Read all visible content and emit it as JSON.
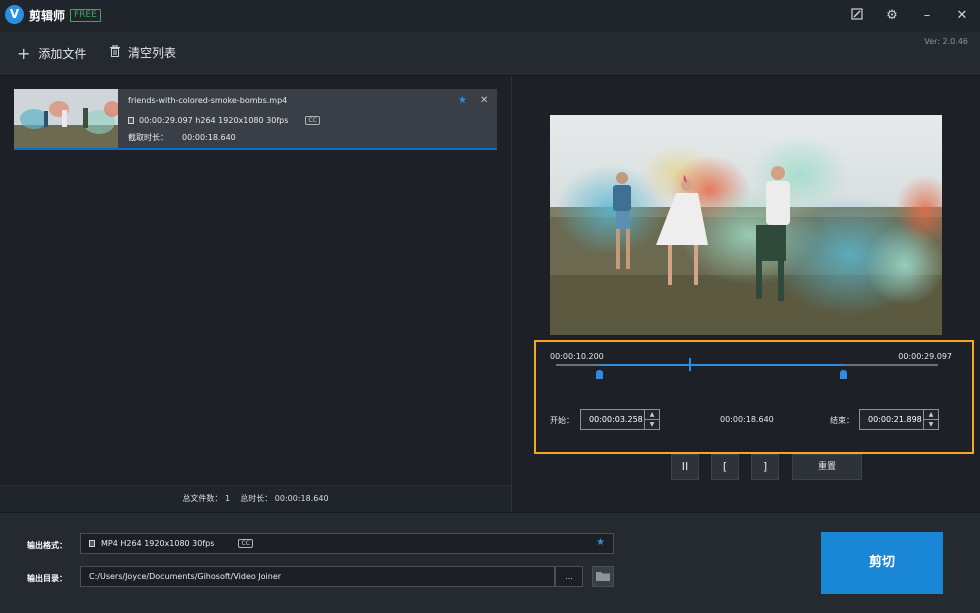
{
  "app": {
    "title": "剪辑师",
    "badge": "FREE",
    "version": "Ver: 2.0.46"
  },
  "toolbar": {
    "add_file": "添加文件",
    "clear_list": "清空列表"
  },
  "file": {
    "name": "friends-with-colored-smoke-bombs.mp4",
    "meta": "00:00:29.097 h264 1920x1080 30fps",
    "meta_tag": "CC",
    "clip_label": "截取时长：",
    "clip_duration": "00:00:18.640"
  },
  "summary": {
    "file_count_label": "总文件数：",
    "file_count": "1",
    "total_label": "总时长：",
    "total_duration": "00:00:18.640"
  },
  "trim": {
    "current_time": "00:00:10.200",
    "total_time": "00:00:29.097",
    "start_label": "开始：",
    "start_value": "00:00:03.258",
    "duration": "00:00:18.640",
    "end_label": "结束：",
    "end_value": "00:00:21.898",
    "start_fraction": 0.112,
    "end_fraction": 0.752,
    "playhead_fraction": 0.351
  },
  "controls": {
    "pause": "II",
    "mark_in": "[",
    "mark_out": "]",
    "reset": "重置"
  },
  "output": {
    "format_label": "输出格式：",
    "format_value": "MP4 H264 1920x1080 30fps",
    "format_tag": "CC",
    "dir_label": "输出目录：",
    "dir_value": "C:/Users/Joyce/Documents/Gihosoft/Video Joiner",
    "browse": "...",
    "cut_button": "剪切"
  },
  "colors": {
    "accent": "#1a87d6",
    "highlight_box": "#f5a623",
    "badge_green": "#3aa757"
  }
}
